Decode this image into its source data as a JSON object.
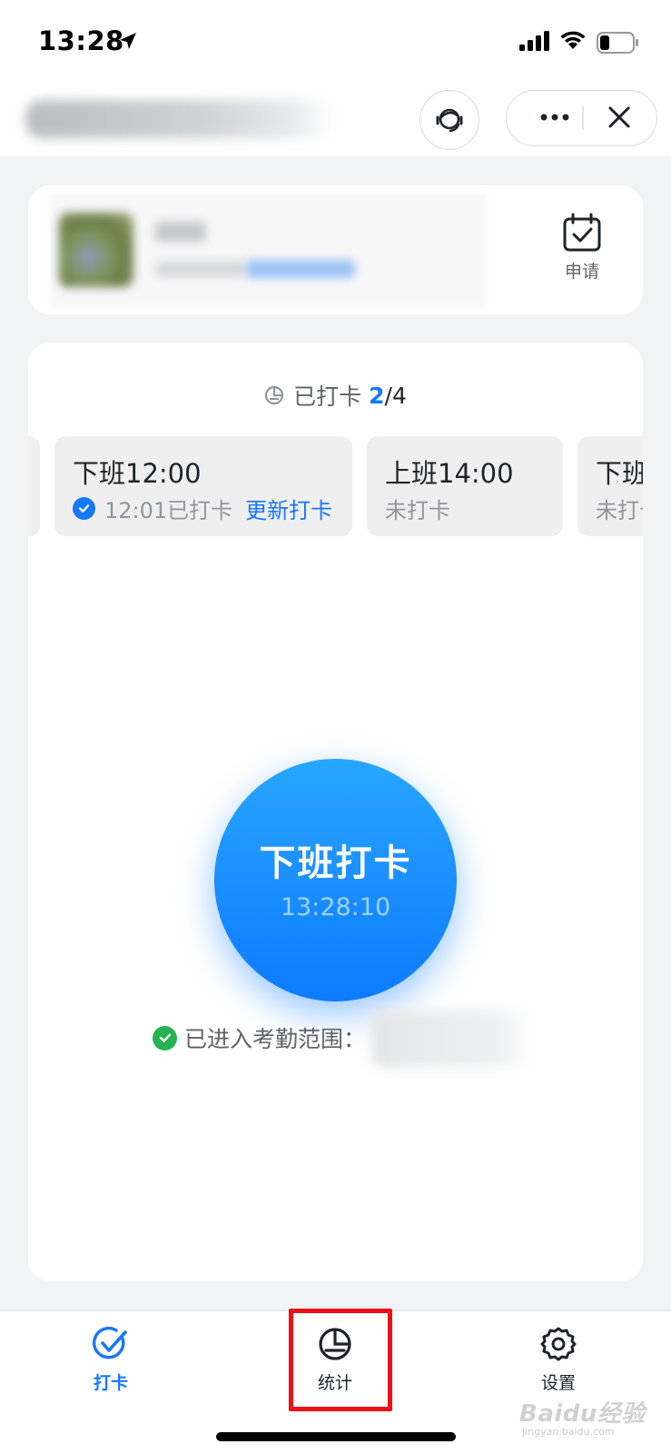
{
  "status_bar": {
    "time": "13:28"
  },
  "header": {
    "title": ""
  },
  "user_card": {
    "apply_label": "申请"
  },
  "attendance": {
    "progress_prefix": "已打卡",
    "done_count": "2",
    "total_text": "/4",
    "shifts": [
      {
        "title": "",
        "status": ""
      },
      {
        "title": "下班12:00",
        "status": "12:01已打卡",
        "action": "更新打卡",
        "checked": true
      },
      {
        "title": "上班14:00",
        "status": "未打卡",
        "checked": false
      },
      {
        "title": "下班",
        "status": "未打卡",
        "checked": false
      }
    ],
    "punch_label": "下班打卡",
    "punch_time": "13:28:10",
    "range_text": "已进入考勤范围："
  },
  "tabs": [
    {
      "label": "打卡",
      "icon": "check-icon",
      "active": true
    },
    {
      "label": "统计",
      "icon": "pie-chart-icon",
      "active": false
    },
    {
      "label": "设置",
      "icon": "gear-icon",
      "active": false
    }
  ],
  "watermark": {
    "brand": "Baidu经验",
    "url": "jingyan.baidu.com"
  },
  "colors": {
    "accent": "#1677ff",
    "success": "#24b354",
    "highlight": "#ee0f17"
  }
}
